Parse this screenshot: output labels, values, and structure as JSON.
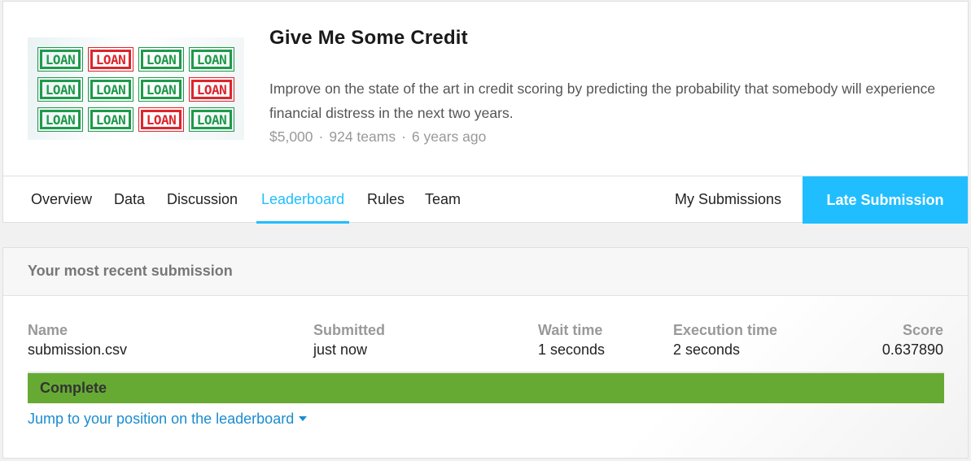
{
  "competition": {
    "banner_stamps": [
      {
        "text": "LOAN",
        "color": "green"
      },
      {
        "text": "LOAN",
        "color": "red"
      },
      {
        "text": "LOAN",
        "color": "green"
      },
      {
        "text": "LOAN",
        "color": "green"
      },
      {
        "text": "LOAN",
        "color": "green"
      },
      {
        "text": "LOAN",
        "color": "green"
      },
      {
        "text": "LOAN",
        "color": "green"
      },
      {
        "text": "LOAN",
        "color": "red"
      },
      {
        "text": "LOAN",
        "color": "green"
      },
      {
        "text": "LOAN",
        "color": "green"
      },
      {
        "text": "LOAN",
        "color": "red"
      },
      {
        "text": "LOAN",
        "color": "green"
      }
    ],
    "title": "Give Me Some Credit",
    "description": "Improve on the state of the art in credit scoring by predicting the probability that somebody will experience financial distress in the next two years.",
    "prize": "$5,000",
    "teams": "924 teams",
    "age": "6 years ago",
    "meta_separator": "·"
  },
  "tabs": {
    "overview": "Overview",
    "data": "Data",
    "discussion": "Discussion",
    "leaderboard": "Leaderboard",
    "rules": "Rules",
    "team": "Team",
    "my_submissions": "My Submissions",
    "late_submission": "Late Submission",
    "active": "Leaderboard"
  },
  "submission": {
    "heading": "Your most recent submission",
    "name_label": "Name",
    "name_value": "submission.csv",
    "submitted_label": "Submitted",
    "submitted_value": "just now",
    "wait_label": "Wait time",
    "wait_value": "1 seconds",
    "exec_label": "Execution time",
    "exec_value": "2 seconds",
    "score_label": "Score",
    "score_value": "0.637890",
    "status": "Complete",
    "jump_link": "Jump to your position on the leaderboard"
  },
  "colors": {
    "accent": "#20beff",
    "complete": "#66aa33",
    "link": "#1a8ccf",
    "stamp_green": "#1d9a4a",
    "stamp_red": "#e0242b"
  },
  "icons": {
    "jump_caret": "caret-down-icon"
  }
}
